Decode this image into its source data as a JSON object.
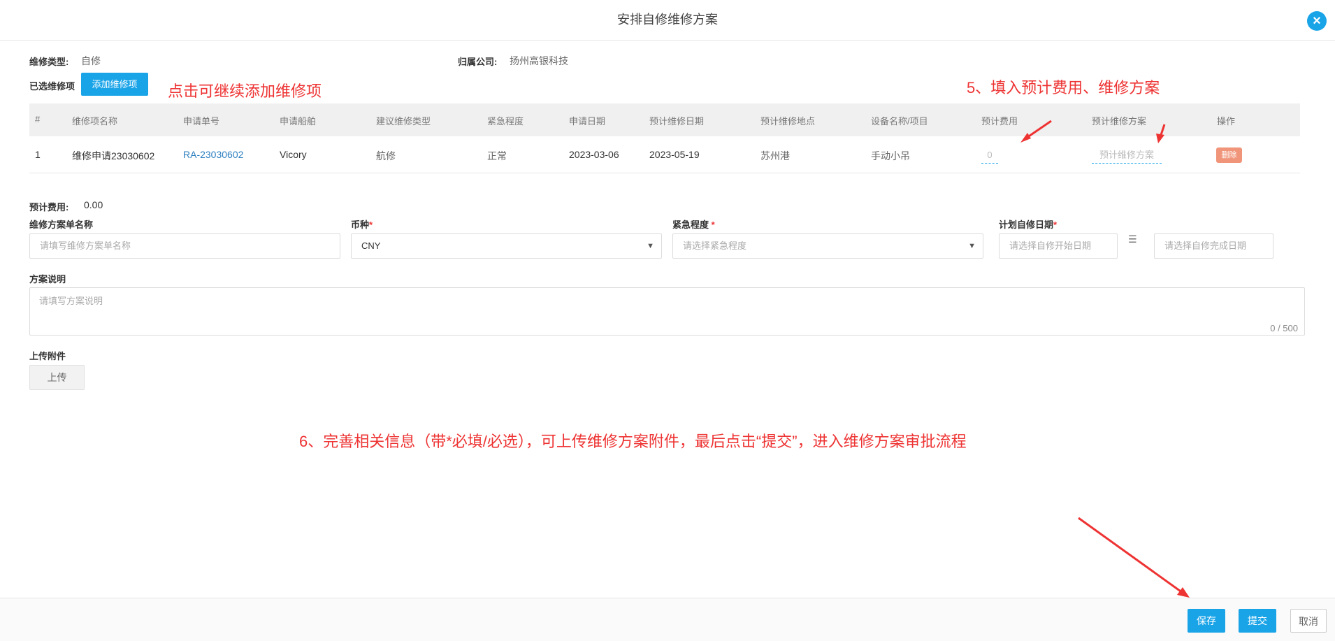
{
  "dialog": {
    "title": "安排自修维修方案",
    "close_icon": "close-icon"
  },
  "info": {
    "repair_type_label": "维修类型:",
    "repair_type_value": "自修",
    "company_label": "归属公司:",
    "company_value": "扬州高银科技",
    "selected_label": "已选维修项",
    "add_button": "添加维修项"
  },
  "annotations": {
    "a1": "点击可继续添加维修项",
    "a5": "5、填入预计费用、维修方案",
    "a6": "6、完善相关信息（带*必填/必选），可上传维修方案附件，最后点击“提交”，进入维修方案审批流程"
  },
  "table": {
    "headers": [
      "#",
      "维修项名称",
      "申请单号",
      "申请船舶",
      "建议维修类型",
      "紧急程度",
      "申请日期",
      "预计维修日期",
      "预计维修地点",
      "设备名称/项目",
      "预计费用",
      "预计维修方案",
      "操作"
    ],
    "rows": [
      {
        "index": "1",
        "name": "维修申请23030602",
        "request_no": "RA-23030602",
        "ship": "Vicory",
        "suggest_type": "航修",
        "urgency": "正常",
        "apply_date": "2023-03-06",
        "plan_date": "2023-05-19",
        "location": "苏州港",
        "equipment": "手动小吊",
        "cost": "0",
        "plan_placeholder": "预计维修方案",
        "delete": "删除"
      }
    ]
  },
  "form": {
    "est_cost_label": "预计费用:",
    "est_cost_value": "0.00",
    "plan_name_label": "维修方案单名称",
    "plan_name_placeholder": "请填写维修方案单名称",
    "currency_label": "币种",
    "currency_value": "CNY",
    "urgency_label": "紧急程度",
    "urgency_placeholder": "请选择紧急程度",
    "plan_date_label": "计划自修日期",
    "start_placeholder": "请选择自修开始日期",
    "end_placeholder": "请选择自修完成日期",
    "required_mark": "*",
    "desc_label": "方案说明",
    "desc_placeholder": "请填写方案说明",
    "desc_counter": "0 / 500",
    "upload_label": "上传附件",
    "upload_button": "上传"
  },
  "footer": {
    "save": "保存",
    "submit": "提交",
    "cancel": "取消"
  },
  "colors": {
    "accent": "#1aa4e8",
    "annotation": "#ee3333",
    "delete": "#f0957a"
  }
}
